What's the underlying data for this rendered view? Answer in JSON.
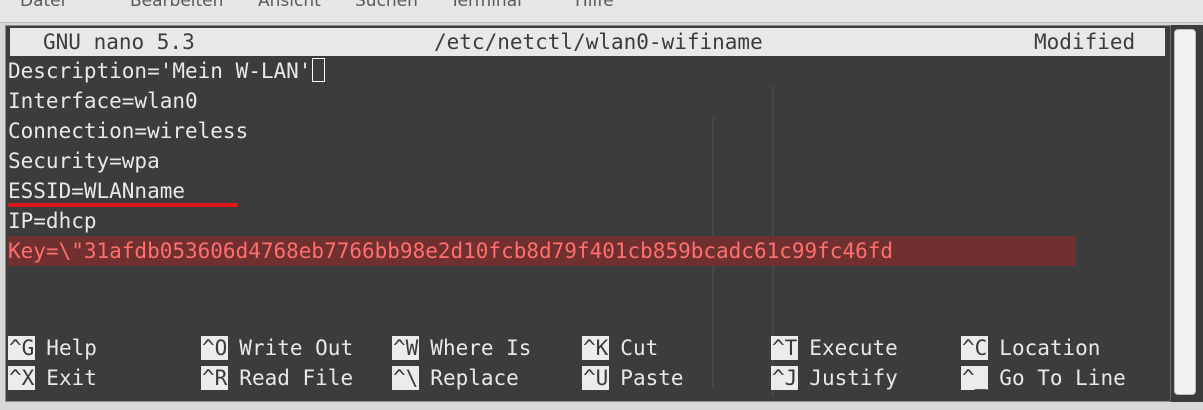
{
  "menubar": {
    "items": [
      "Datei",
      "Bearbeiten",
      "Ansicht",
      "Suchen",
      "Terminal",
      "Hilfe"
    ]
  },
  "nano": {
    "version": "GNU nano 5.3",
    "filename": "/etc/netctl/wlan0-wifiname",
    "status": "Modified"
  },
  "file": {
    "lines": [
      "Description='Mein W-LAN'",
      "Interface=wlan0",
      "Connection=wireless",
      "Security=wpa",
      "ESSID=WLANname",
      "IP=dhcp",
      "Key=\\\"31afdb053606d4768eb7766bb98e2d10fcb8d79f401cb859bcadc61c99fc46fd"
    ]
  },
  "shortcuts": {
    "row1": [
      {
        "key": "^G",
        "label": "Help"
      },
      {
        "key": "^O",
        "label": "Write Out"
      },
      {
        "key": "^W",
        "label": "Where Is"
      },
      {
        "key": "^K",
        "label": "Cut"
      },
      {
        "key": "^T",
        "label": "Execute"
      },
      {
        "key": "^C",
        "label": "Location"
      }
    ],
    "row2": [
      {
        "key": "^X",
        "label": "Exit"
      },
      {
        "key": "^R",
        "label": "Read File"
      },
      {
        "key": "^\\",
        "label": "Replace"
      },
      {
        "key": "^U",
        "label": "Paste"
      },
      {
        "key": "^J",
        "label": "Justify"
      },
      {
        "key": "^_",
        "label": "Go To Line"
      }
    ]
  },
  "colors": {
    "terminal_bg": "#3c3c3c",
    "text": "#e8e8e8",
    "titlebar_bg": "#e8e8e8",
    "highlight_bg": "#703030",
    "highlight_text": "#ff6f6f",
    "annotation_underline": "#e0161b"
  }
}
